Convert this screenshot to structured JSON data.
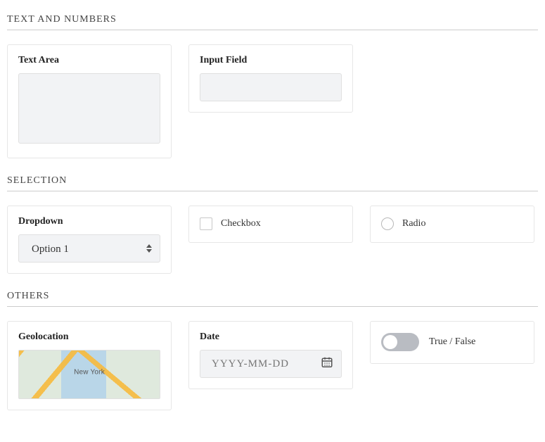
{
  "sections": {
    "text_numbers": {
      "title": "TEXT AND NUMBERS"
    },
    "selection": {
      "title": "SELECTION"
    },
    "others": {
      "title": "OTHERS"
    }
  },
  "text_area": {
    "label": "Text Area",
    "value": ""
  },
  "input_field": {
    "label": "Input Field",
    "value": ""
  },
  "dropdown": {
    "label": "Dropdown",
    "selected": "Option 1"
  },
  "checkbox": {
    "label": "Checkbox",
    "checked": false
  },
  "radio": {
    "label": "Radio",
    "checked": false
  },
  "geolocation": {
    "label": "Geolocation",
    "map_label": "New York"
  },
  "date": {
    "label": "Date",
    "placeholder": "YYYY-MM-DD",
    "value": ""
  },
  "toggle": {
    "label": "True / False",
    "value": false
  }
}
